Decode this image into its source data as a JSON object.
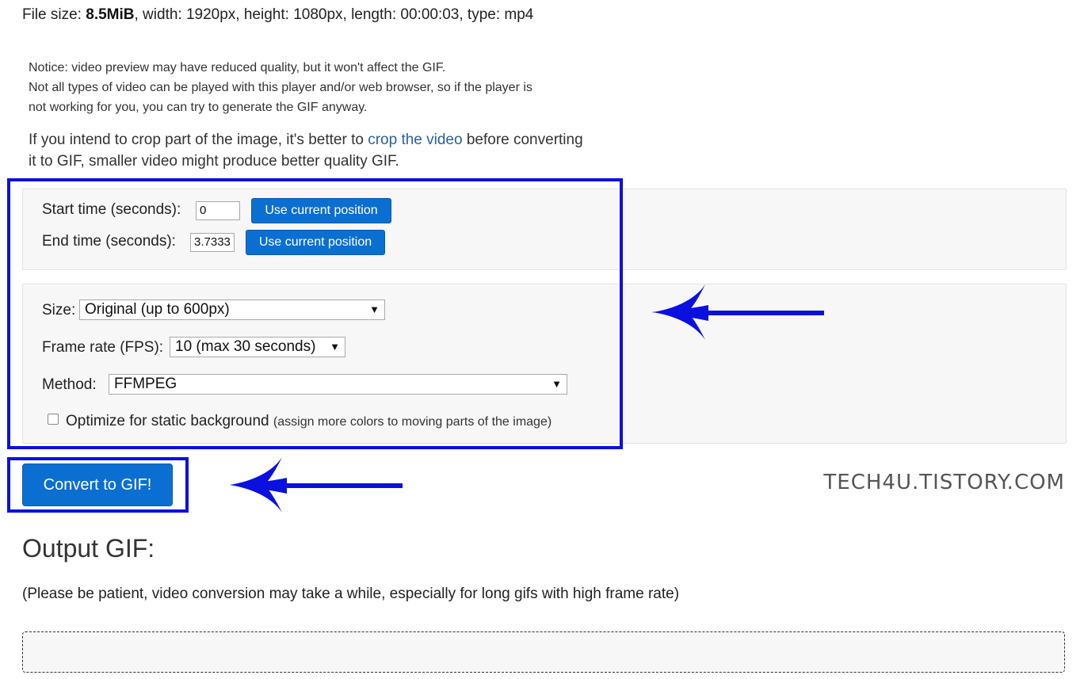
{
  "file_info": {
    "label": "File size:",
    "size": "8.5MiB",
    "details": ", width: 1920px, height: 1080px, length: 00:00:03, type: mp4"
  },
  "notice": {
    "line1": "Notice: video preview may have reduced quality, but it won't affect the GIF.",
    "line2": "Not all types of video can be played with this player and/or web browser, so if the player is",
    "line3": "not working for you, you can try to generate the GIF anyway."
  },
  "crop_note": {
    "before": "If you intend to crop part of the image, it's better to ",
    "link": "crop the video",
    "after": " before converting",
    "line2": "it to GIF, smaller video might produce better quality GIF."
  },
  "time": {
    "start_label": "Start time (seconds):",
    "start_value": "0",
    "end_label": "End time (seconds):",
    "end_value": "3.7333",
    "use_current_label": "Use current position"
  },
  "options": {
    "size_label": "Size:",
    "size_value": "Original (up to 600px)",
    "fps_label": "Frame rate (FPS):",
    "fps_value": "10 (max 30 seconds)",
    "method_label": "Method:",
    "method_value": "FFMPEG",
    "optimize_label": "Optimize for static background",
    "optimize_note": "(assign more colors to moving parts of the image)",
    "optimize_checked": false,
    "dropdown_arrow": "▼"
  },
  "convert_button": "Convert to GIF!",
  "watermark": "TECH4U.TISTORY.COM",
  "output": {
    "title": "Output GIF:",
    "note": "(Please be patient, video conversion may take a while, especially for long gifs with high frame rate)"
  },
  "colors": {
    "annotation_blue": "#0a10e0",
    "button_blue": "#0b6fd1",
    "link_blue": "#2a5d9f"
  },
  "icons": {
    "annotation_arrow": "arrow-left-icon",
    "dropdown": "chevron-down-icon",
    "checkbox": "checkbox-icon"
  }
}
